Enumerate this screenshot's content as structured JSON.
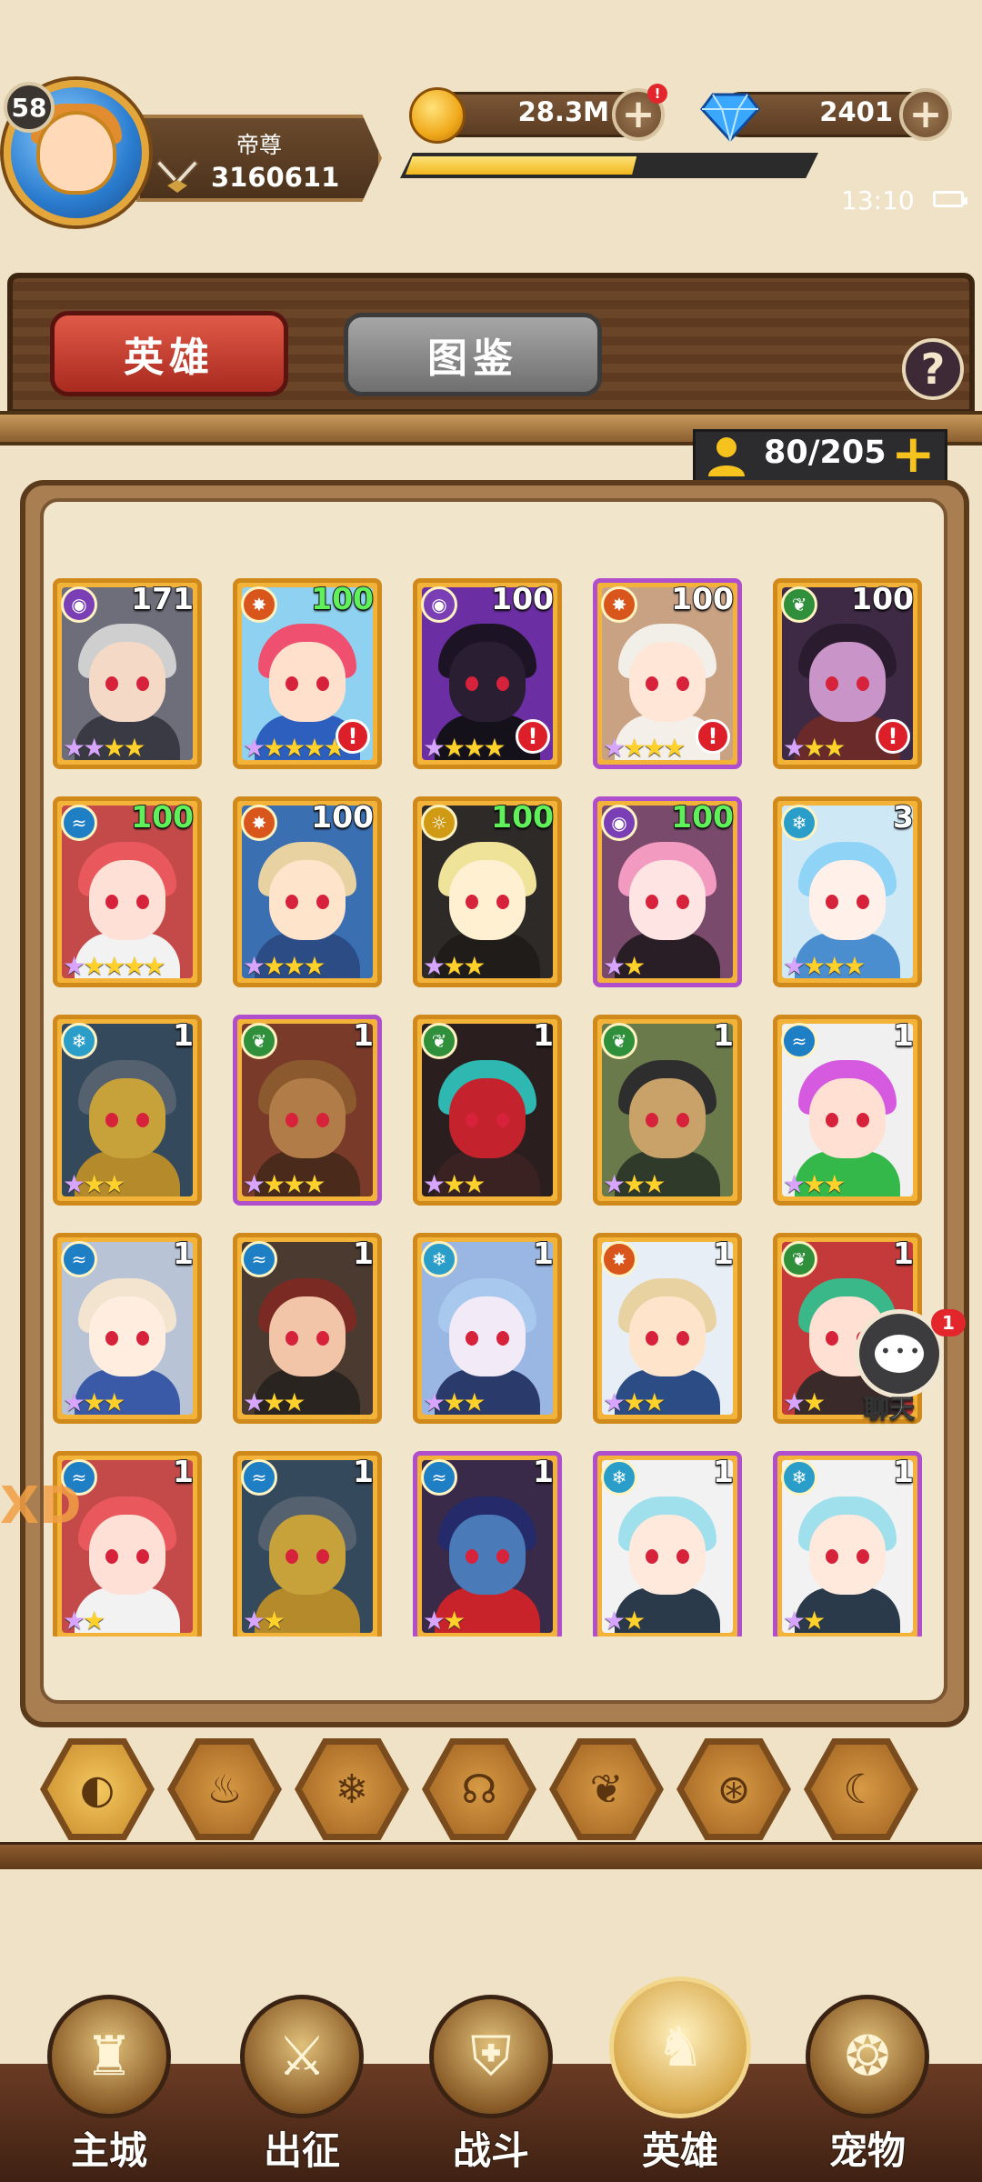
{
  "player": {
    "level": "58",
    "rank_title": "帝尊",
    "power": "3160611"
  },
  "currency": {
    "gold": "28.3M",
    "gold_alert": "!",
    "gems": "2401",
    "plus_label": "+"
  },
  "xp_progress": 0.57,
  "status_bar": {
    "time": "13:10"
  },
  "tabs": {
    "heroes": "英雄",
    "codex": "图鉴",
    "help": "?"
  },
  "capacity": {
    "text": "80/205",
    "plus": "+"
  },
  "elements": {
    "purple": {
      "color": "#7a3fb5",
      "icon": "eye-rune-icon",
      "glyph": "◉"
    },
    "fire": {
      "color": "#d8561c",
      "icon": "fire-icon",
      "glyph": "✸"
    },
    "nature": {
      "color": "#2f8f3a",
      "icon": "leaf-icon",
      "glyph": "❦"
    },
    "water": {
      "color": "#1f7fc4",
      "icon": "wave-icon",
      "glyph": "≈"
    },
    "light": {
      "color": "#d19a14",
      "icon": "sun-icon",
      "glyph": "☼"
    },
    "ice": {
      "color": "#2a9ec9",
      "icon": "snowflake-icon",
      "glyph": "❄"
    }
  },
  "heroes": [
    {
      "level": "171",
      "element": "purple",
      "purple_frame": false,
      "stars_p": 2,
      "stars_g": 2,
      "alert": false,
      "green": false,
      "hair": "#cfcfcf",
      "skin": "#f3d9c6",
      "bg": "#6e6e7a",
      "body": "#3a3a44"
    },
    {
      "level": "100",
      "element": "fire",
      "purple_frame": false,
      "stars_p": 1,
      "stars_g": 4,
      "alert": true,
      "green": true,
      "hair": "#f0506f",
      "skin": "#ffe0cc",
      "bg": "#8fd1f0",
      "body": "#2d5fbf"
    },
    {
      "level": "100",
      "element": "purple",
      "purple_frame": false,
      "stars_p": 1,
      "stars_g": 3,
      "alert": true,
      "green": false,
      "hair": "#1c1424",
      "skin": "#2a1e33",
      "bg": "#6b2fa3",
      "body": "#15111b"
    },
    {
      "level": "100",
      "element": "fire",
      "purple_frame": true,
      "stars_p": 1,
      "stars_g": 3,
      "alert": true,
      "green": false,
      "hair": "#f2eee8",
      "skin": "#ffe6d6",
      "bg": "#c9a183",
      "body": "#f5efe9"
    },
    {
      "level": "100",
      "element": "nature",
      "purple_frame": false,
      "stars_p": 1,
      "stars_g": 2,
      "alert": true,
      "green": false,
      "hair": "#2a1c2e",
      "skin": "#c995c8",
      "bg": "#3e2a44",
      "body": "#6b2a2a"
    },
    {
      "level": "100",
      "element": "water",
      "purple_frame": false,
      "stars_p": 1,
      "stars_g": 4,
      "alert": false,
      "green": true,
      "hair": "#e8585c",
      "skin": "#ffe0d6",
      "bg": "#c44a4a",
      "body": "#f2f2f2"
    },
    {
      "level": "100",
      "element": "fire",
      "purple_frame": false,
      "stars_p": 1,
      "stars_g": 3,
      "alert": false,
      "green": false,
      "hair": "#e8d2a2",
      "skin": "#ffe4cc",
      "bg": "#3a6fb2",
      "body": "#2b4c84"
    },
    {
      "level": "100",
      "element": "light",
      "purple_frame": false,
      "stars_p": 1,
      "stars_g": 2,
      "alert": false,
      "green": true,
      "hair": "#efe39a",
      "skin": "#fff0d2",
      "bg": "#2d2a28",
      "body": "#1f1c1a"
    },
    {
      "level": "100",
      "element": "purple",
      "purple_frame": true,
      "stars_p": 1,
      "stars_g": 1,
      "alert": false,
      "green": true,
      "hair": "#f39ac0",
      "skin": "#ffe4e4",
      "bg": "#7a4a6c",
      "body": "#2a1e26"
    },
    {
      "level": "3",
      "element": "ice",
      "purple_frame": false,
      "stars_p": 1,
      "stars_g": 3,
      "alert": false,
      "green": false,
      "hair": "#8fd4f6",
      "skin": "#fff0ea",
      "bg": "#cfe8f6",
      "body": "#4a8ed0"
    },
    {
      "level": "1",
      "element": "ice",
      "purple_frame": false,
      "stars_p": 1,
      "stars_g": 2,
      "alert": false,
      "green": false,
      "hair": "#55616e",
      "skin": "#c7a23a",
      "bg": "#34495c",
      "body": "#b58a2a"
    },
    {
      "level": "1",
      "element": "nature",
      "purple_frame": true,
      "stars_p": 1,
      "stars_g": 3,
      "alert": false,
      "green": false,
      "hair": "#8a5a2e",
      "skin": "#b27c48",
      "bg": "#7a3a2a",
      "body": "#4a2a1a"
    },
    {
      "level": "1",
      "element": "nature",
      "purple_frame": false,
      "stars_p": 1,
      "stars_g": 2,
      "alert": false,
      "green": false,
      "hair": "#2fb8b2",
      "skin": "#c4222c",
      "bg": "#2b1e1e",
      "body": "#3a2222"
    },
    {
      "level": "1",
      "element": "nature",
      "purple_frame": false,
      "stars_p": 1,
      "stars_g": 2,
      "alert": false,
      "green": false,
      "hair": "#2e2e2e",
      "skin": "#c9a26a",
      "bg": "#6a7a4a",
      "body": "#2f3a2a"
    },
    {
      "level": "1",
      "element": "water",
      "purple_frame": false,
      "stars_p": 1,
      "stars_g": 2,
      "alert": false,
      "green": false,
      "hair": "#d65ae0",
      "skin": "#ffe0d2",
      "bg": "#f0f0f0",
      "body": "#34b84a"
    },
    {
      "level": "1",
      "element": "water",
      "purple_frame": false,
      "stars_p": 1,
      "stars_g": 2,
      "alert": false,
      "green": false,
      "hair": "#f3e4cf",
      "skin": "#ffeee0",
      "bg": "#b8c4d6",
      "body": "#3a5aa8"
    },
    {
      "level": "1",
      "element": "water",
      "purple_frame": false,
      "stars_p": 1,
      "stars_g": 2,
      "alert": false,
      "green": false,
      "hair": "#7a2a22",
      "skin": "#f2c4a8",
      "bg": "#4a3a30",
      "body": "#2a2420"
    },
    {
      "level": "1",
      "element": "ice",
      "purple_frame": false,
      "stars_p": 1,
      "stars_g": 2,
      "alert": false,
      "green": false,
      "hair": "#a8c8ee",
      "skin": "#f2eaf6",
      "bg": "#9ab6e2",
      "body": "#2a3a6a"
    },
    {
      "level": "1",
      "element": "fire",
      "purple_frame": false,
      "stars_p": 1,
      "stars_g": 2,
      "alert": false,
      "green": false,
      "hair": "#e8d2a2",
      "skin": "#ffe4cc",
      "bg": "#e8eef6",
      "body": "#2b4c84"
    },
    {
      "level": "1",
      "element": "nature",
      "purple_frame": false,
      "stars_p": 1,
      "stars_g": 1,
      "alert": false,
      "green": false,
      "hair": "#3ab88a",
      "skin": "#ffe0d2",
      "bg": "#c43a3a",
      "body": "#3a2a2a"
    },
    {
      "level": "1",
      "element": "water",
      "purple_frame": false,
      "stars_p": 1,
      "stars_g": 1,
      "alert": false,
      "green": false,
      "hair": "#e8585c",
      "skin": "#ffe0d6",
      "bg": "#c44a4a",
      "body": "#f2f2f2"
    },
    {
      "level": "1",
      "element": "water",
      "purple_frame": false,
      "stars_p": 1,
      "stars_g": 1,
      "alert": false,
      "green": false,
      "hair": "#55616e",
      "skin": "#c7a23a",
      "bg": "#34495c",
      "body": "#b58a2a"
    },
    {
      "level": "1",
      "element": "water",
      "purple_frame": true,
      "stars_p": 1,
      "stars_g": 1,
      "alert": false,
      "green": false,
      "hair": "#242a6a",
      "skin": "#4a7ab8",
      "bg": "#3a2a4a",
      "body": "#c8222a"
    },
    {
      "level": "1",
      "element": "ice",
      "purple_frame": true,
      "stars_p": 1,
      "stars_g": 1,
      "alert": false,
      "green": false,
      "hair": "#9fe0ec",
      "skin": "#ffe8dc",
      "bg": "#f2f2f2",
      "body": "#2a3a4a"
    },
    {
      "level": "1",
      "element": "ice",
      "purple_frame": true,
      "stars_p": 1,
      "stars_g": 1,
      "alert": false,
      "green": false,
      "hair": "#9fe0ec",
      "skin": "#ffe8dc",
      "bg": "#f2f2f2",
      "body": "#2a3a4a"
    }
  ],
  "filters": [
    {
      "name": "filter-all",
      "icon": "all-elements-icon",
      "glyph": "◐"
    },
    {
      "name": "filter-fire",
      "icon": "fire-icon",
      "glyph": "♨"
    },
    {
      "name": "filter-ice",
      "icon": "snowflake-icon",
      "glyph": "❄"
    },
    {
      "name": "filter-water",
      "icon": "wave-icon",
      "glyph": "☊"
    },
    {
      "name": "filter-nature",
      "icon": "leaf-icon",
      "glyph": "❦"
    },
    {
      "name": "filter-dark",
      "icon": "eye-rune-icon",
      "glyph": "⊛"
    },
    {
      "name": "filter-light",
      "icon": "sun-icon",
      "glyph": "☾"
    }
  ],
  "chat": {
    "label": "聊天",
    "badge": "1"
  },
  "watermark": "XD",
  "nav": [
    {
      "id": "nav-main-city",
      "label": "主城",
      "icon": "castle-icon",
      "glyph": "♜"
    },
    {
      "id": "nav-expedition",
      "label": "出征",
      "icon": "crossed-axes-icon",
      "glyph": "⚔"
    },
    {
      "id": "nav-battle",
      "label": "战斗",
      "icon": "shield-swords-icon",
      "glyph": "⛨"
    },
    {
      "id": "nav-heroes",
      "label": "英雄",
      "icon": "hooded-hero-icon",
      "glyph": "♞"
    },
    {
      "id": "nav-pets",
      "label": "宠物",
      "icon": "dragon-icon",
      "glyph": "❂"
    }
  ]
}
